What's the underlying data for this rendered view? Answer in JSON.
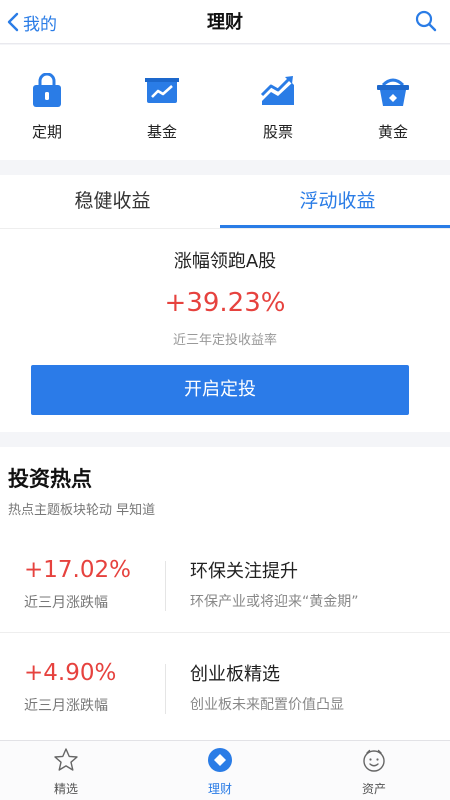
{
  "nav": {
    "back_label": "我的",
    "title": "理财"
  },
  "categories": [
    {
      "label": "定期",
      "icon": "lock-bag-icon"
    },
    {
      "label": "基金",
      "icon": "fund-chart-icon"
    },
    {
      "label": "股票",
      "icon": "stock-chart-icon"
    },
    {
      "label": "黄金",
      "icon": "gold-basket-icon"
    }
  ],
  "tabs": [
    {
      "label": "稳健收益",
      "active": false
    },
    {
      "label": "浮动收益",
      "active": true
    }
  ],
  "featured": {
    "name": "涨幅领跑A股",
    "rate": "+39.23%",
    "rate_desc": "近三年定投收益率",
    "button": "开启定投"
  },
  "hotspots": {
    "title": "投资热点",
    "subtitle": "热点主题板块轮动 早知道",
    "items": [
      {
        "rate": "+17.02%",
        "rate_label": "近三月涨跌幅",
        "name": "环保关注提升",
        "desc": "环保产业或将迎来“黄金期”"
      },
      {
        "rate": "+4.90%",
        "rate_label": "近三月涨跌幅",
        "name": "创业板精选",
        "desc": "创业板未来配置价值凸显"
      }
    ]
  },
  "tabbar": [
    {
      "label": "精选",
      "icon": "star-icon",
      "active": false
    },
    {
      "label": "理财",
      "icon": "finance-diamond-icon",
      "active": true
    },
    {
      "label": "资产",
      "icon": "smiley-icon",
      "active": false
    }
  ],
  "colors": {
    "accent": "#2a7ce6",
    "gain": "#e6423e"
  }
}
